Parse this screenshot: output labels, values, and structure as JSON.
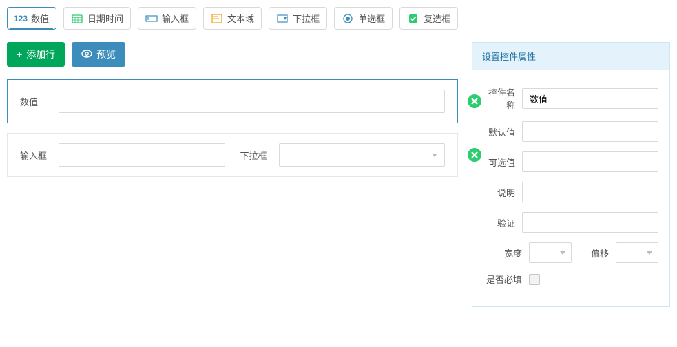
{
  "toolbar": {
    "items": [
      {
        "id": "number",
        "label": "数值"
      },
      {
        "id": "datetime",
        "label": "日期时间"
      },
      {
        "id": "input",
        "label": "输入框"
      },
      {
        "id": "textarea",
        "label": "文本域"
      },
      {
        "id": "select",
        "label": "下拉框"
      },
      {
        "id": "radio",
        "label": "单选框"
      },
      {
        "id": "checkbox",
        "label": "复选框"
      }
    ]
  },
  "actions": {
    "add_row": "添加行",
    "preview": "预览"
  },
  "rows": [
    {
      "fields": [
        {
          "label": "数值",
          "type": "text"
        }
      ]
    },
    {
      "fields": [
        {
          "label": "输入框",
          "type": "text"
        },
        {
          "label": "下拉框",
          "type": "select"
        }
      ]
    }
  ],
  "props_panel": {
    "title": "设置控件属性",
    "labels": {
      "name": "控件名称",
      "default": "默认值",
      "options": "可选值",
      "desc": "说明",
      "validate": "验证",
      "width": "宽度",
      "offset": "偏移",
      "required": "是否必填"
    },
    "values": {
      "name": "数值",
      "default": "",
      "options": "",
      "desc": "",
      "validate": "",
      "required": false
    }
  },
  "icons": {
    "number_text": "123"
  }
}
